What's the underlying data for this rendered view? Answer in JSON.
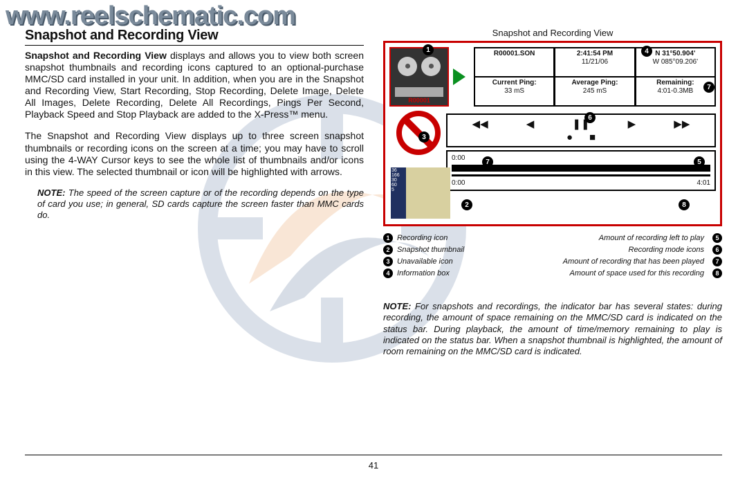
{
  "watermark_url": "www.reelschematic.com",
  "heading": "Snapshot and Recording View",
  "para1_lead": "Snapshot and Recording View",
  "para1_rest": " displays and allows you to view both screen snapshot thumbnails and recording icons captured to an optional-purchase MMC/SD card installed in your unit. In addition, when you are in the Snapshot and Recording View, Start Recording, Stop Recording, Delete Image, Delete All Images, Delete Recording, Delete All Recordings, Pings Per Second, Playback Speed and Stop Playback are added to the X-Press™ menu.",
  "para2": "The Snapshot and Recording View displays up to three screen snapshot thumbnails or recording icons on the screen at a time; you may have to scroll using the 4-WAY Cursor keys to see the whole list of thumbnails and/or icons in this view. The selected thumbnail or icon will be highlighted with arrows.",
  "note1_label": "NOTE:",
  "note1_text": " The speed of the screen capture or of the recording depends on the type of card you use; in general, SD cards capture the screen faster than MMC cards do.",
  "figure_caption": "Snapshot and Recording View",
  "device": {
    "thumb_label": "R00001",
    "info": {
      "file": "R00001.SON",
      "time": "2:41:54 PM",
      "date": "11/21/06",
      "lat": "N 31°50.904'",
      "lon": "W 085°09.206'",
      "ping_cur_label": "Current Ping:",
      "ping_cur_val": "33 mS",
      "ping_avg_label": "Average Ping:",
      "ping_avg_val": "245 mS",
      "remain_label": "Remaining:",
      "remain_val": "4:01-0.3MB"
    },
    "sonar_depths": [
      "36",
      "166",
      "30",
      "60",
      "5"
    ],
    "timeline": {
      "elapsed": "0:00",
      "play_start": "0:00",
      "play_end": "4:01"
    }
  },
  "legend_left": [
    {
      "n": "1",
      "t": "Recording icon"
    },
    {
      "n": "2",
      "t": "Snapshot thumbnail"
    },
    {
      "n": "3",
      "t": "Unavailable icon"
    },
    {
      "n": "4",
      "t": "Information box"
    }
  ],
  "legend_right": [
    {
      "n": "5",
      "t": "Amount of recording left to play"
    },
    {
      "n": "6",
      "t": "Recording mode icons"
    },
    {
      "n": "7",
      "t": "Amount of recording that has been played"
    },
    {
      "n": "8",
      "t": "Amount of space used for this recording"
    }
  ],
  "note2_label": "NOTE:",
  "note2_text": " For snapshots and recordings, the indicator bar has several states: during recording, the amount of space remaining on the MMC/SD card is indicated on the status bar. During playback, the amount of time/memory remaining to play is indicated on the status bar. When a snapshot thumbnail is highlighted, the amount of room remaining on the MMC/SD card is indicated.",
  "page_number": "41"
}
